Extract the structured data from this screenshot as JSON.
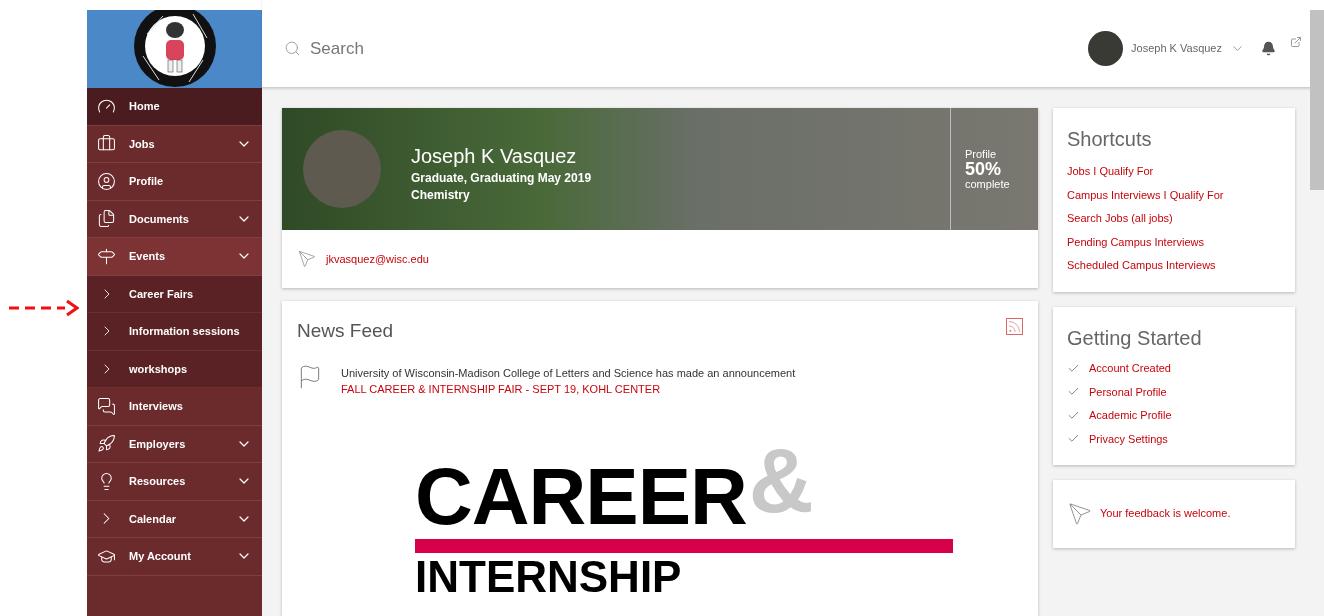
{
  "header": {
    "search": {
      "placeholder": "Search"
    },
    "user": {
      "name": "Joseph K Vasquez"
    }
  },
  "sidebar": {
    "items": [
      {
        "label": "Home",
        "kind": "link",
        "selected": true,
        "expanded": false
      },
      {
        "label": "Jobs",
        "kind": "group",
        "selected": false,
        "expanded": false
      },
      {
        "label": "Profile",
        "kind": "link",
        "selected": false,
        "expanded": false
      },
      {
        "label": "Documents",
        "kind": "group",
        "selected": false,
        "expanded": false
      },
      {
        "label": "Events",
        "kind": "group",
        "selected": false,
        "expanded": true,
        "children": [
          {
            "label": "Career Fairs",
            "selected": false
          },
          {
            "label": "Information sessions",
            "selected": false
          },
          {
            "label": "workshops",
            "selected": false
          }
        ]
      },
      {
        "label": "Interviews",
        "kind": "link",
        "selected": false,
        "expanded": false
      },
      {
        "label": "Employers",
        "kind": "group",
        "selected": false,
        "expanded": false
      },
      {
        "label": "Resources",
        "kind": "group",
        "selected": false,
        "expanded": false
      },
      {
        "label": "Calendar",
        "kind": "group",
        "selected": false,
        "expanded": false
      },
      {
        "label": "My Account",
        "kind": "group",
        "selected": false,
        "expanded": false
      }
    ]
  },
  "profile_card": {
    "name": "Joseph K Vasquez",
    "status": "Graduate, Graduating May 2019",
    "major": "Chemistry",
    "completion": {
      "label": "Profile",
      "percent": "50%",
      "suffix": "complete"
    },
    "email": "jkvasquez@wisc.edu"
  },
  "news_feed": {
    "title": "News Feed",
    "items": [
      {
        "source": "University of Wisconsin-Madison College of Letters and Science has made an announcement",
        "headline": "FALL CAREER & INTERNSHIP FAIR - SEPT 19, KOHL CENTER",
        "poster": {
          "line_1": "CAREER",
          "ampersand": "&",
          "line_2": "INTERNSHIP"
        }
      }
    ]
  },
  "shortcuts": {
    "title": "Shortcuts",
    "links": [
      "Jobs I Qualify For",
      "Campus Interviews I Qualify For",
      "Search Jobs (all jobs)",
      "Pending Campus Interviews",
      "Scheduled Campus Interviews"
    ]
  },
  "getting_started": {
    "title": "Getting Started",
    "steps": [
      {
        "label": "Account Created",
        "checked": true
      },
      {
        "label": "Personal Profile",
        "checked": true
      },
      {
        "label": "Academic Profile",
        "checked": true
      },
      {
        "label": "Privacy Settings",
        "checked": true
      }
    ]
  },
  "feedback": {
    "text": "Your feedback is welcome."
  }
}
